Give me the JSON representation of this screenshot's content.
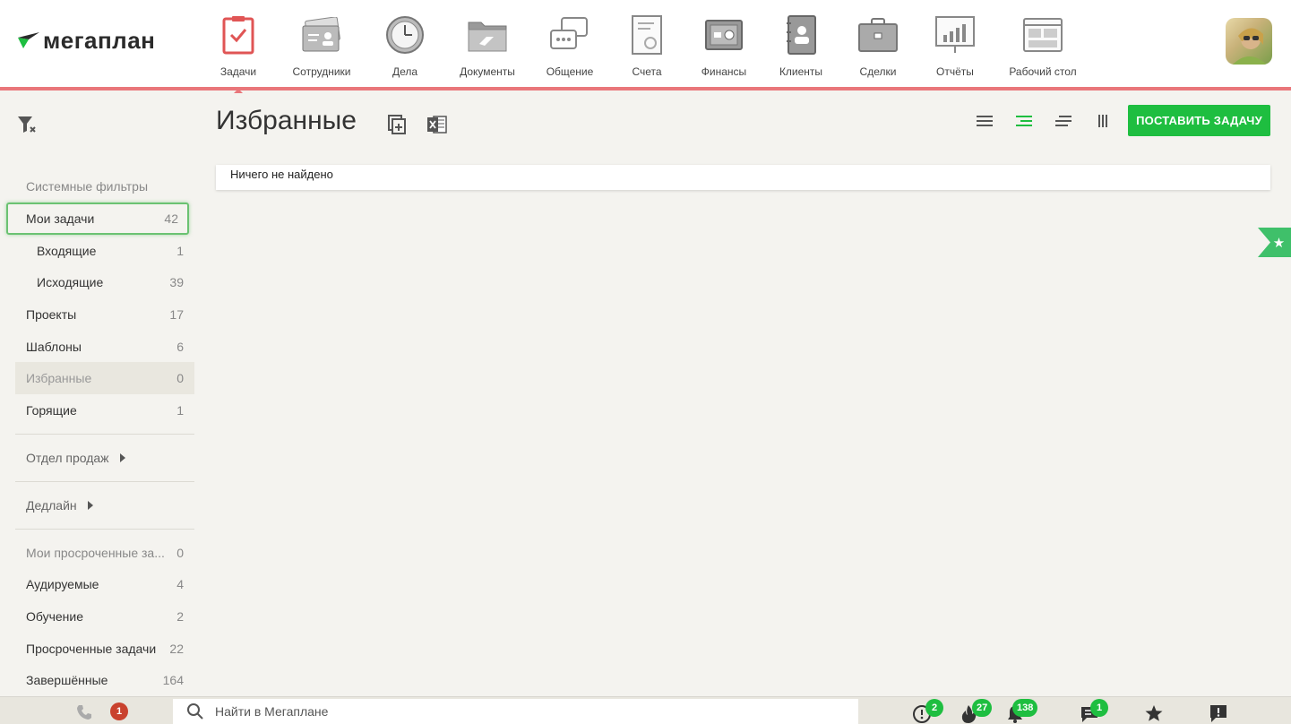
{
  "app": {
    "logo_text": "мегаплан"
  },
  "nav": [
    {
      "id": "tasks",
      "label": "Задачи",
      "active": true
    },
    {
      "id": "employees",
      "label": "Сотрудники"
    },
    {
      "id": "deals-cases",
      "label": "Дела"
    },
    {
      "id": "documents",
      "label": "Документы"
    },
    {
      "id": "communication",
      "label": "Общение"
    },
    {
      "id": "invoices",
      "label": "Счета"
    },
    {
      "id": "finances",
      "label": "Финансы"
    },
    {
      "id": "clients",
      "label": "Клиенты"
    },
    {
      "id": "deals",
      "label": "Сделки"
    },
    {
      "id": "reports",
      "label": "Отчёты"
    },
    {
      "id": "desktop",
      "label": "Рабочий стол"
    }
  ],
  "sidebar": {
    "system_filters_label": "Системные фильтры",
    "items": [
      {
        "label": "Мои задачи",
        "count": "42"
      },
      {
        "label": "Входящие",
        "count": "1"
      },
      {
        "label": "Исходящие",
        "count": "39"
      },
      {
        "label": "Проекты",
        "count": "17"
      },
      {
        "label": "Шаблоны",
        "count": "6"
      },
      {
        "label": "Избранные",
        "count": "0"
      },
      {
        "label": "Горящие",
        "count": "1"
      }
    ],
    "groups": [
      {
        "label": "Отдел продаж"
      },
      {
        "label": "Дедлайн"
      }
    ],
    "custom": [
      {
        "label": "Мои просроченные за...",
        "count": "0"
      },
      {
        "label": "Аудируемые",
        "count": "4"
      },
      {
        "label": "Обучение",
        "count": "2"
      },
      {
        "label": "Просроченные задачи",
        "count": "22"
      },
      {
        "label": "Завершённые",
        "count": "164"
      }
    ]
  },
  "main": {
    "title": "Избранные",
    "create_button": "ПОСТАВИТЬ ЗАДАЧУ",
    "empty_message": "Ничего не найдено"
  },
  "bottom": {
    "missed_calls": "1",
    "search_placeholder": "Найти в Мегаплане",
    "alerts": "2",
    "hot": "27",
    "notifications": "138",
    "messages": "1"
  },
  "colors": {
    "accent_green": "#1ebe40",
    "nav_underline": "#e9767a",
    "badge_red": "#c9422e"
  }
}
